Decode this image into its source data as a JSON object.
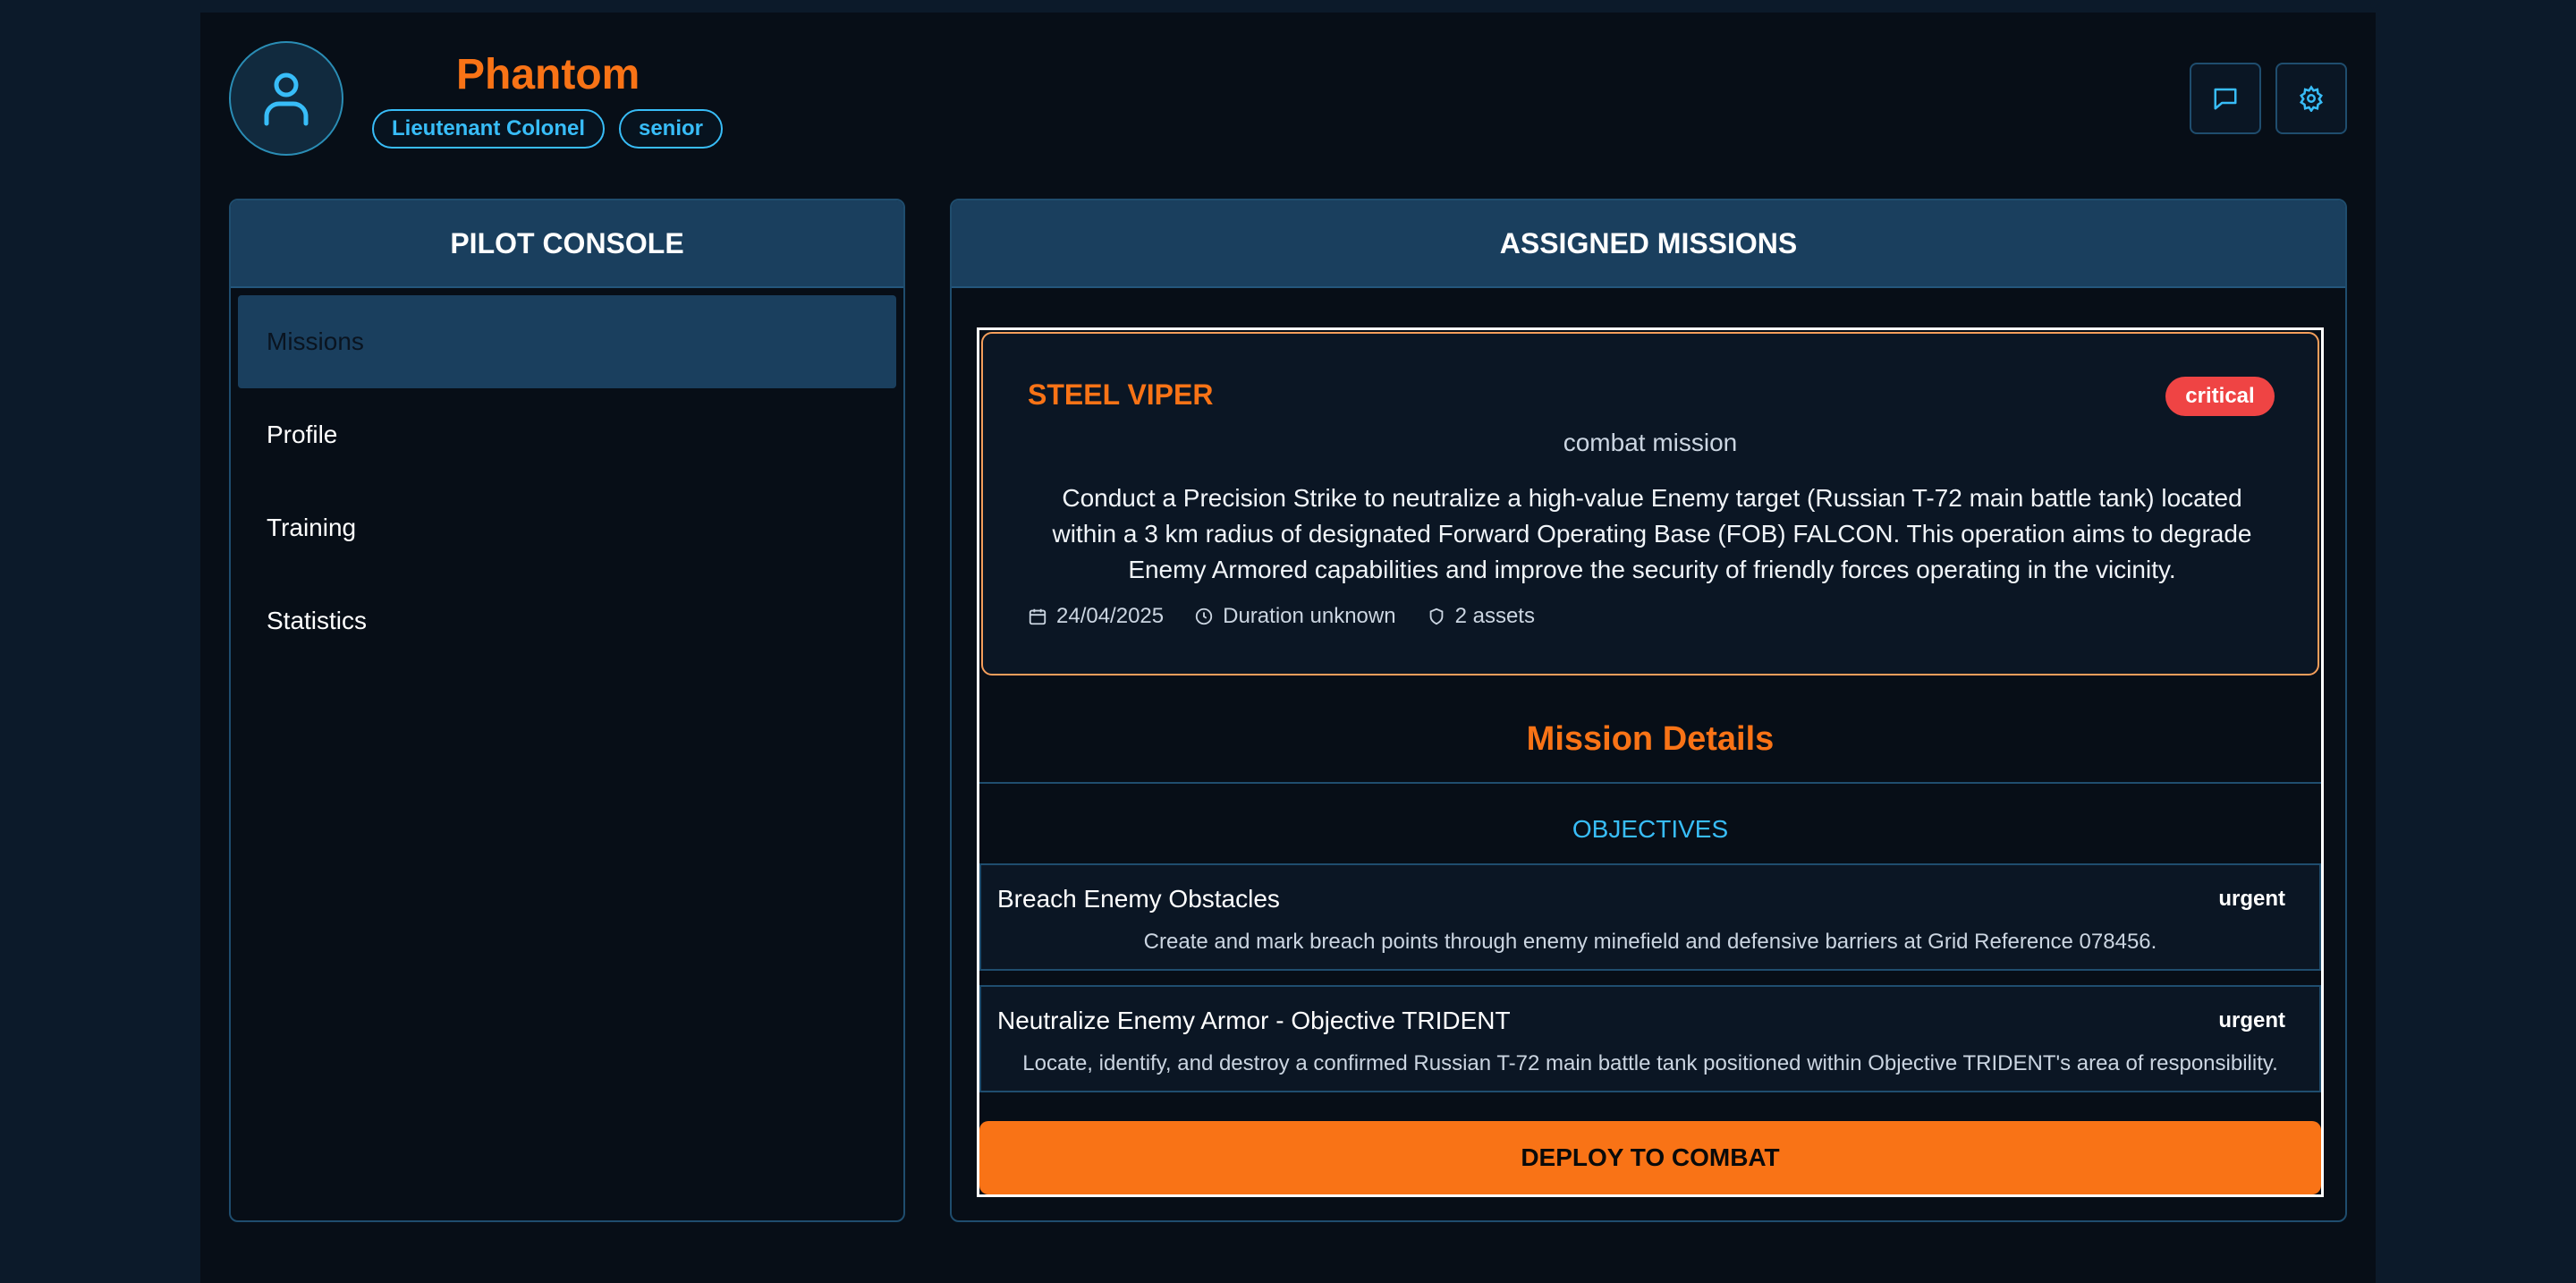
{
  "header": {
    "pilot_name": "Phantom",
    "rank": "Lieutenant Colonel",
    "level": "senior",
    "icons": {
      "avatar": "user-icon",
      "messages": "message-square-icon",
      "settings": "gear-icon"
    }
  },
  "sidebar": {
    "title": "PILOT CONSOLE",
    "items": [
      {
        "label": "Missions",
        "active": true
      },
      {
        "label": "Profile",
        "active": false
      },
      {
        "label": "Training",
        "active": false
      },
      {
        "label": "Statistics",
        "active": false
      }
    ]
  },
  "main": {
    "title": "ASSIGNED MISSIONS",
    "mission": {
      "name": "STEEL VIPER",
      "priority": "critical",
      "type": "combat mission",
      "description": "Conduct a Precision Strike to neutralize a high-value Enemy target (Russian T-72 main battle tank) located within a 3 km radius of designated Forward Operating Base (FOB) FALCON. This operation aims to degrade Enemy Armored capabilities and improve the security of friendly forces operating in the vicinity.",
      "date": "24/04/2025",
      "duration": "Duration unknown",
      "assets": "2 assets"
    },
    "details_title": "Mission Details",
    "objectives_heading": "OBJECTIVES",
    "objectives": [
      {
        "title": "Breach Enemy Obstacles",
        "priority": "urgent",
        "description": "Create and mark breach points through enemy minefield and defensive barriers at Grid Reference 078456."
      },
      {
        "title": "Neutralize Enemy Armor - Objective TRIDENT",
        "priority": "urgent",
        "description": "Locate, identify, and destroy a confirmed Russian T-72 main battle tank positioned within Objective TRIDENT's area of responsibility."
      }
    ],
    "deploy_label": "DEPLOY TO COMBAT"
  },
  "colors": {
    "accent_orange": "#f97316",
    "accent_blue": "#38bdf8",
    "critical_red": "#ef4444",
    "panel_header": "#1a3f5e",
    "background": "#070e17"
  }
}
